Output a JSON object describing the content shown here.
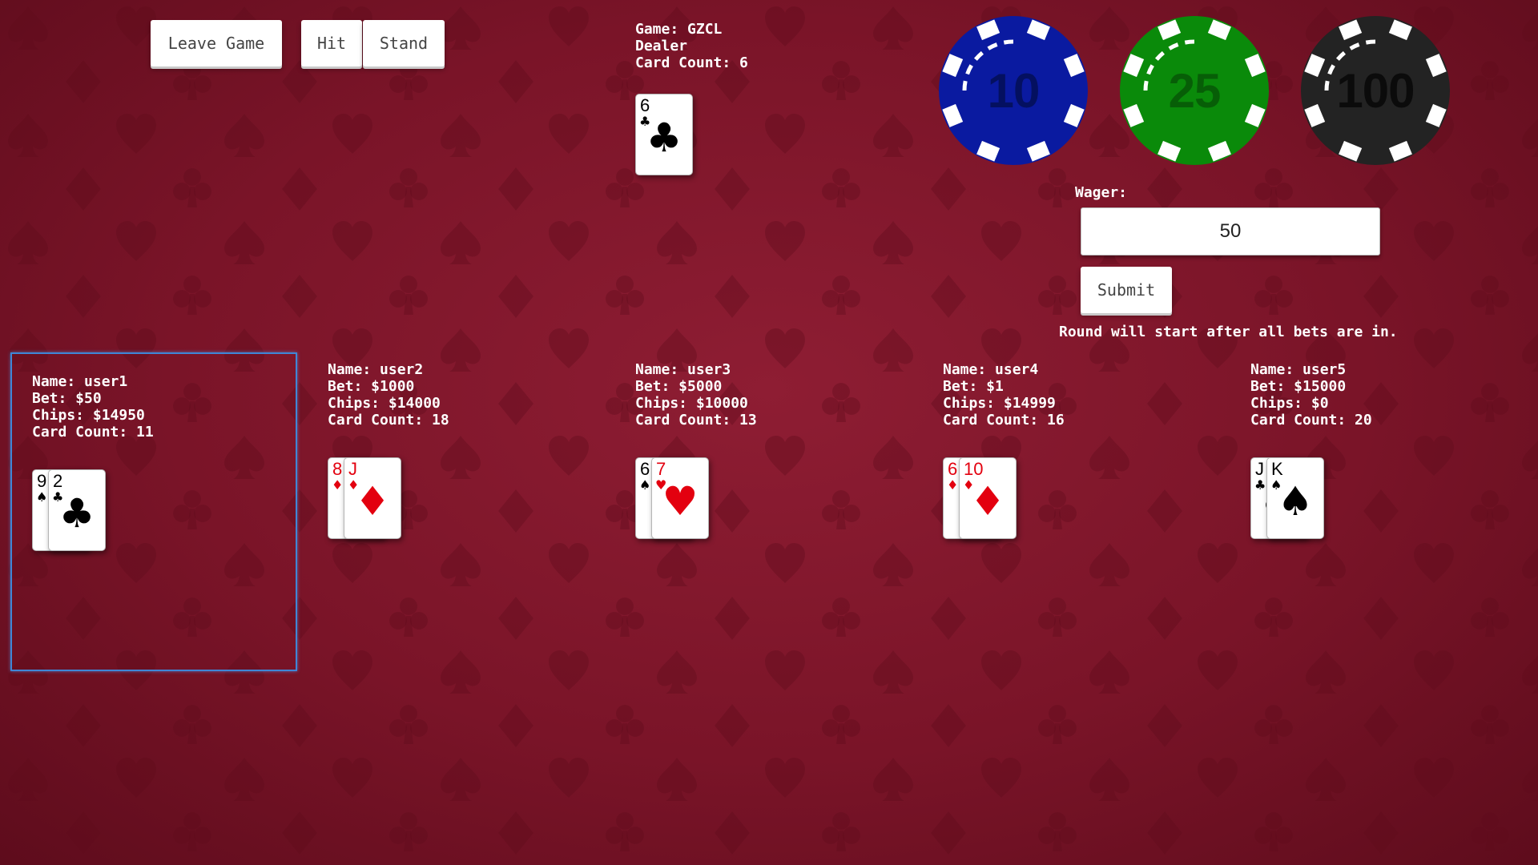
{
  "controls": {
    "leave_label": "Leave Game",
    "hit_label": "Hit",
    "stand_label": "Stand"
  },
  "dealer": {
    "game_line": "Game: GZCL",
    "title": "Dealer",
    "card_count_line": "Card Count: 6",
    "cards": [
      {
        "rank": "6",
        "suit": "♣",
        "color": "black"
      }
    ]
  },
  "chips": [
    {
      "value": "10",
      "color": "#0a1aa0",
      "text_color": "#041060"
    },
    {
      "value": "25",
      "color": "#0a8a0a",
      "text_color": "#075e07"
    },
    {
      "value": "100",
      "color": "#232323",
      "text_color": "#0b0b0b"
    }
  ],
  "wager": {
    "label": "Wager:",
    "value": "50",
    "submit_label": "Submit"
  },
  "status_message": "Round will start after all bets are in.",
  "players": [
    {
      "name_line": "Name: user1",
      "bet_line": "Bet: $50",
      "chips_line": "Chips: $14950",
      "card_count_line": "Card Count: 11",
      "active": true,
      "cards": [
        {
          "rank": "9",
          "suit": "♠",
          "color": "black"
        },
        {
          "rank": "2",
          "suit": "♣",
          "color": "black"
        }
      ]
    },
    {
      "name_line": "Name: user2",
      "bet_line": "Bet: $1000",
      "chips_line": "Chips: $14000",
      "card_count_line": "Card Count: 18",
      "active": false,
      "cards": [
        {
          "rank": "8",
          "suit": "♦",
          "color": "red"
        },
        {
          "rank": "J",
          "suit": "♦",
          "color": "red"
        }
      ]
    },
    {
      "name_line": "Name: user3",
      "bet_line": "Bet: $5000",
      "chips_line": "Chips: $10000",
      "card_count_line": "Card Count: 13",
      "active": false,
      "cards": [
        {
          "rank": "6",
          "suit": "♠",
          "color": "black"
        },
        {
          "rank": "7",
          "suit": "♥",
          "color": "red"
        }
      ]
    },
    {
      "name_line": "Name: user4",
      "bet_line": "Bet: $1",
      "chips_line": "Chips: $14999",
      "card_count_line": "Card Count: 16",
      "active": false,
      "cards": [
        {
          "rank": "6",
          "suit": "♦",
          "color": "red"
        },
        {
          "rank": "10",
          "suit": "♦",
          "color": "red"
        }
      ]
    },
    {
      "name_line": "Name: user5",
      "bet_line": "Bet: $15000",
      "chips_line": "Chips: $0",
      "card_count_line": "Card Count: 20",
      "active": false,
      "cards": [
        {
          "rank": "J",
          "suit": "♣",
          "color": "black"
        },
        {
          "rank": "K",
          "suit": "♠",
          "color": "black"
        }
      ]
    }
  ]
}
